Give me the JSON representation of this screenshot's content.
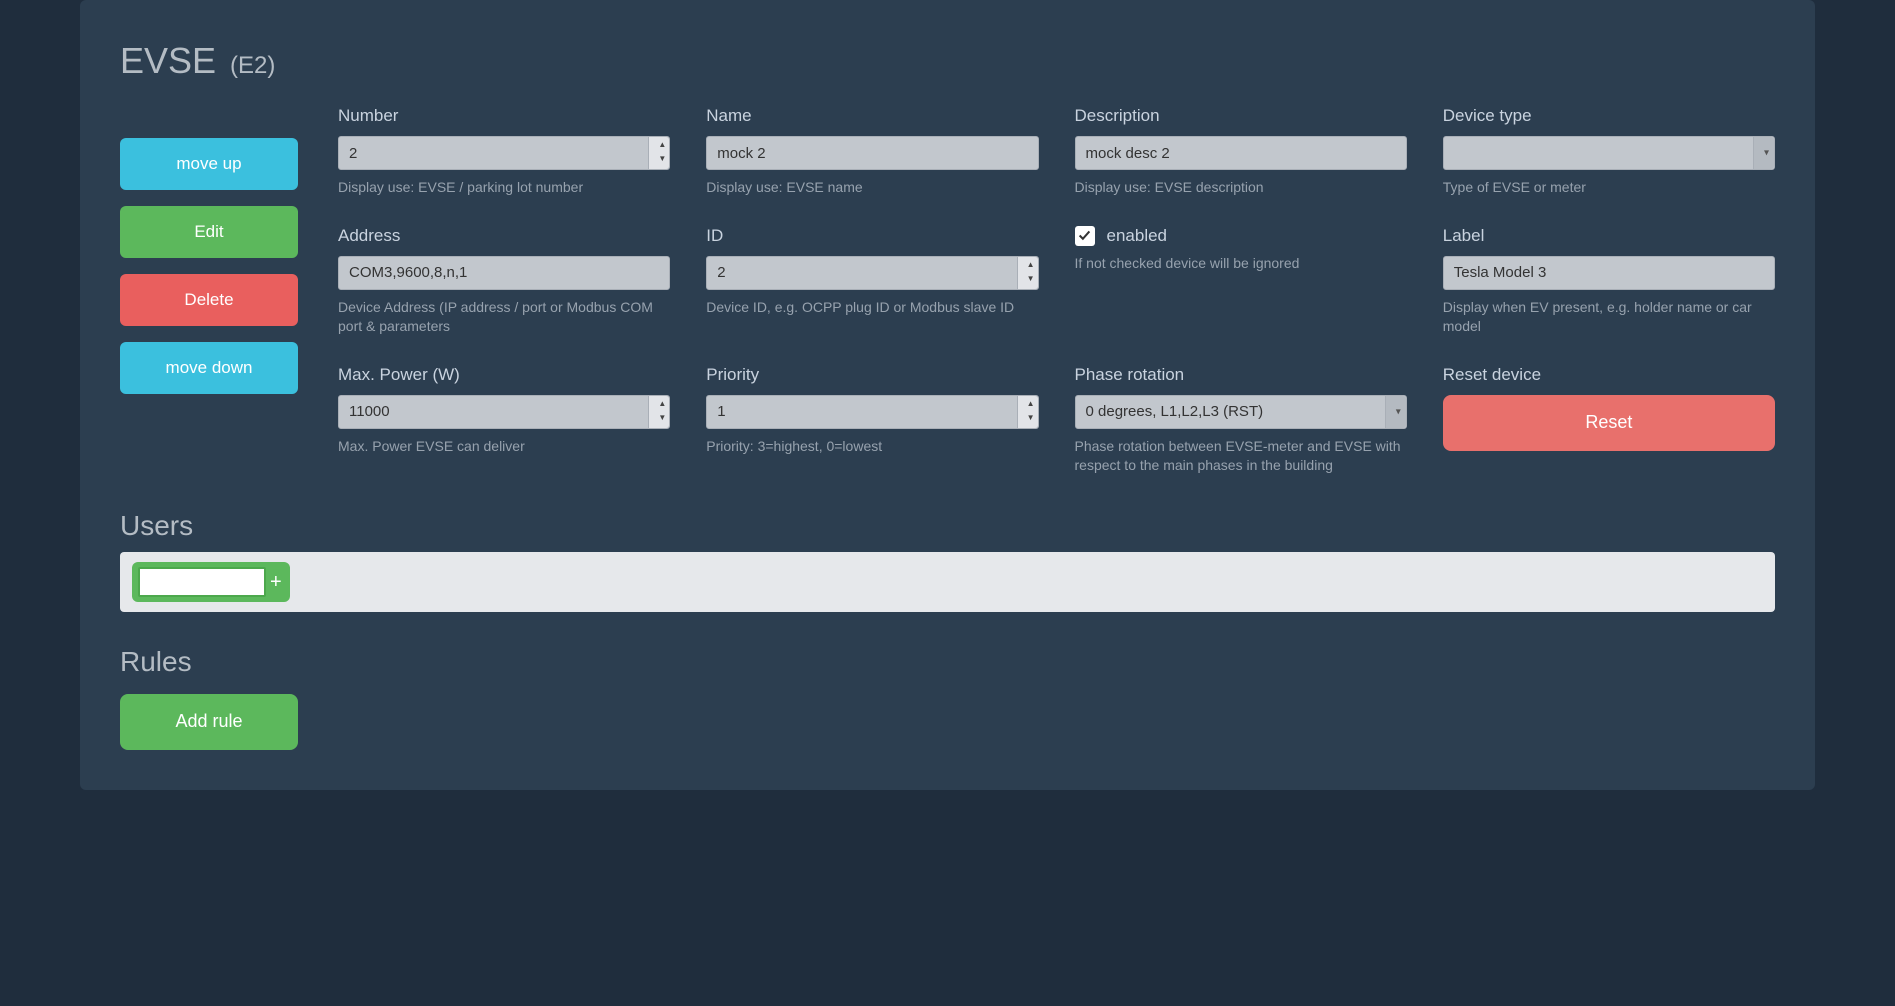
{
  "header": {
    "title": "EVSE",
    "sub": "(E2)"
  },
  "actions": {
    "move_up": "move up",
    "edit": "Edit",
    "delete": "Delete",
    "move_down": "move down"
  },
  "fields": {
    "number": {
      "label": "Number",
      "value": "2",
      "hint": "Display use: EVSE / parking lot number"
    },
    "name": {
      "label": "Name",
      "value": "mock 2",
      "hint": "Display use: EVSE name"
    },
    "description": {
      "label": "Description",
      "value": "mock desc 2",
      "hint": "Display use: EVSE description"
    },
    "device_type": {
      "label": "Device type",
      "value": "",
      "hint": "Type of EVSE or meter"
    },
    "address": {
      "label": "Address",
      "value": "COM3,9600,8,n,1",
      "hint": "Device Address (IP address / port or Modbus COM port & parameters"
    },
    "id": {
      "label": "ID",
      "value": "2",
      "hint": "Device ID, e.g. OCPP plug ID or Modbus slave ID"
    },
    "enabled": {
      "label": "enabled",
      "checked": true,
      "hint": "If not checked device will be ignored"
    },
    "label_f": {
      "label": "Label",
      "value": "Tesla Model 3",
      "hint": "Display when EV present, e.g. holder name or car model"
    },
    "max_power": {
      "label": "Max. Power (W)",
      "value": "11000",
      "hint": "Max. Power EVSE can deliver"
    },
    "priority": {
      "label": "Priority",
      "value": "1",
      "hint": "Priority: 3=highest, 0=lowest"
    },
    "phase": {
      "label": "Phase rotation",
      "value": "0 degrees, L1,L2,L3 (RST)",
      "hint": "Phase rotation between EVSE-meter and EVSE with respect to the main phases in the building"
    },
    "reset": {
      "label": "Reset device",
      "button": "Reset"
    }
  },
  "users": {
    "title": "Users",
    "add_value": "",
    "plus": "+"
  },
  "rules": {
    "title": "Rules",
    "add_button": "Add rule"
  }
}
